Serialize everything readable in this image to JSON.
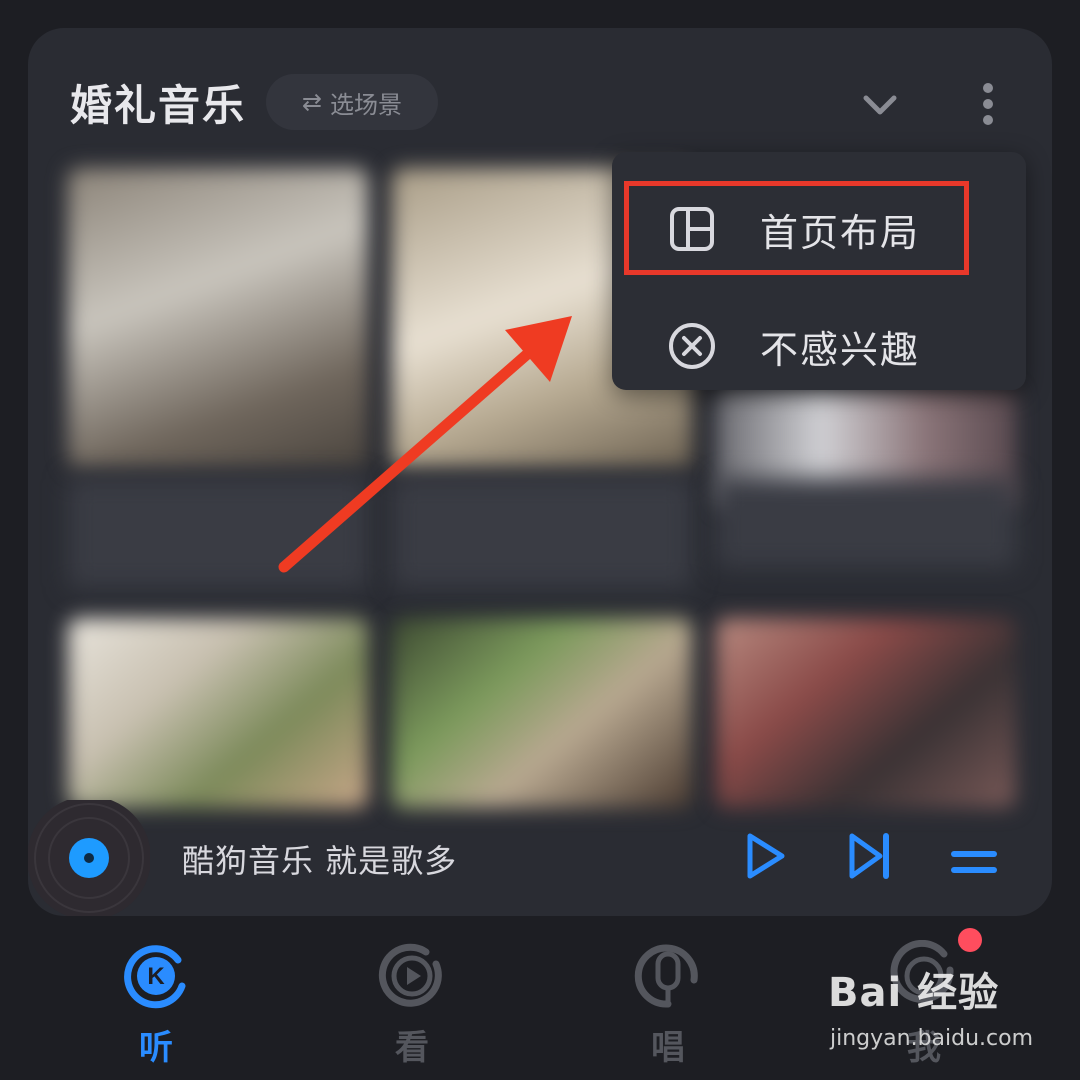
{
  "card": {
    "title": "婚礼音乐",
    "scene_chip": {
      "icon": "swap-icon",
      "label": "选场景"
    }
  },
  "menu": {
    "items": [
      {
        "icon": "layout-icon",
        "label": "首页布局",
        "highlighted": true
      },
      {
        "icon": "close-circle-icon",
        "label": "不感兴趣"
      }
    ]
  },
  "annotation": {
    "highlight_color": "#e8382a",
    "arrow_color": "#ef3b22"
  },
  "player": {
    "text": "酷狗音乐  就是歌多",
    "accent": "#2a8cff"
  },
  "nav": {
    "items": [
      {
        "label": "听",
        "icon": "kugou-k-icon",
        "active": true
      },
      {
        "label": "看",
        "icon": "play-circle-icon",
        "active": false
      },
      {
        "label": "唱",
        "icon": "microphone-icon",
        "active": false
      },
      {
        "label": "我",
        "icon": "profile-icon",
        "active": false,
        "badge": true
      }
    ],
    "active_color": "#2a8cff",
    "inactive_color": "#54565d"
  },
  "watermark": {
    "text": "Bai 经验",
    "url": "jingyan.baidu.com"
  }
}
